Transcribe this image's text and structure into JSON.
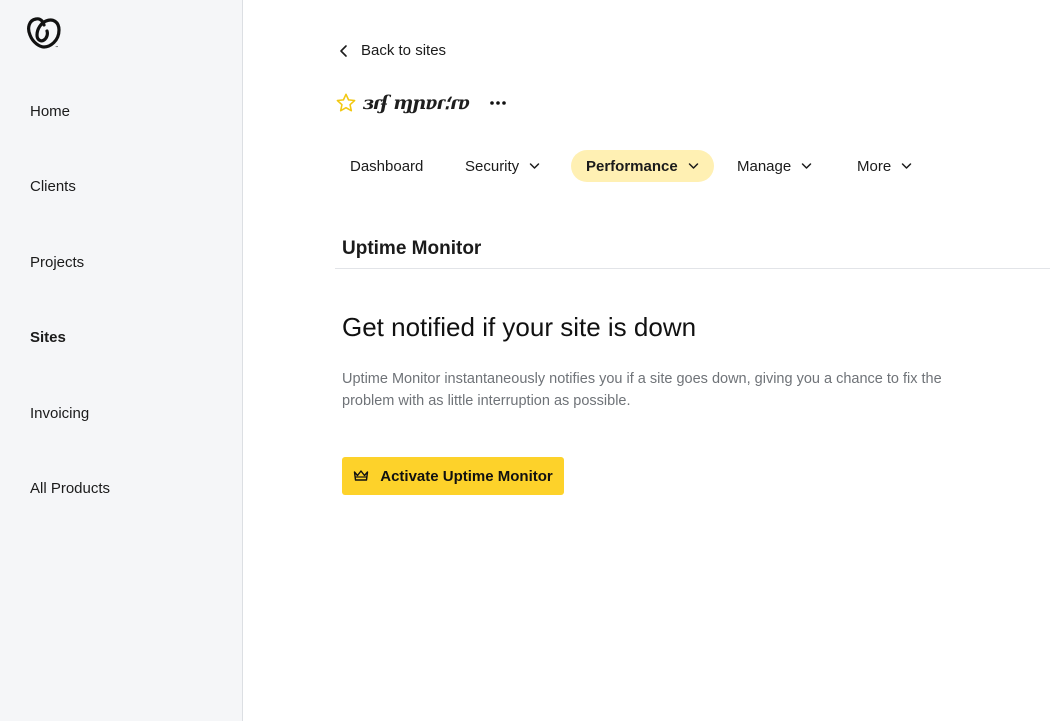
{
  "brand": {
    "logo": "godaddy-logo-icon"
  },
  "sidebar": {
    "items": [
      {
        "label": "Home"
      },
      {
        "label": "Clients"
      },
      {
        "label": "Projects"
      },
      {
        "label": "Sites",
        "active": true
      },
      {
        "label": "Invoicing"
      },
      {
        "label": "All Products"
      }
    ]
  },
  "header": {
    "back_label": "Back to sites",
    "site_name": "ɜɾʄ ɱɲɐɾ؛ɾɐ",
    "more_icon": "more-dots-icon",
    "favorite_icon": "star-icon"
  },
  "tabs": [
    {
      "label": "Dashboard",
      "has_menu": false
    },
    {
      "label": "Security",
      "has_menu": true
    },
    {
      "label": "Performance",
      "has_menu": true,
      "active": true
    },
    {
      "label": "Manage",
      "has_menu": true
    },
    {
      "label": "More",
      "has_menu": true
    }
  ],
  "section": {
    "title": "Uptime Monitor"
  },
  "promo": {
    "headline": "Get notified if your site is down",
    "description": "Uptime Monitor instantaneously notifies you if a site goes down, giving you a chance to fix the problem with as little interruption as possible.",
    "button_label": "Activate Uptime Monitor",
    "button_icon": "crown-icon"
  },
  "colors": {
    "accent": "#fdd22a",
    "active_tab": "#fff0b3",
    "star": "#f2c811",
    "sidebar_bg": "#f5f6f8"
  }
}
